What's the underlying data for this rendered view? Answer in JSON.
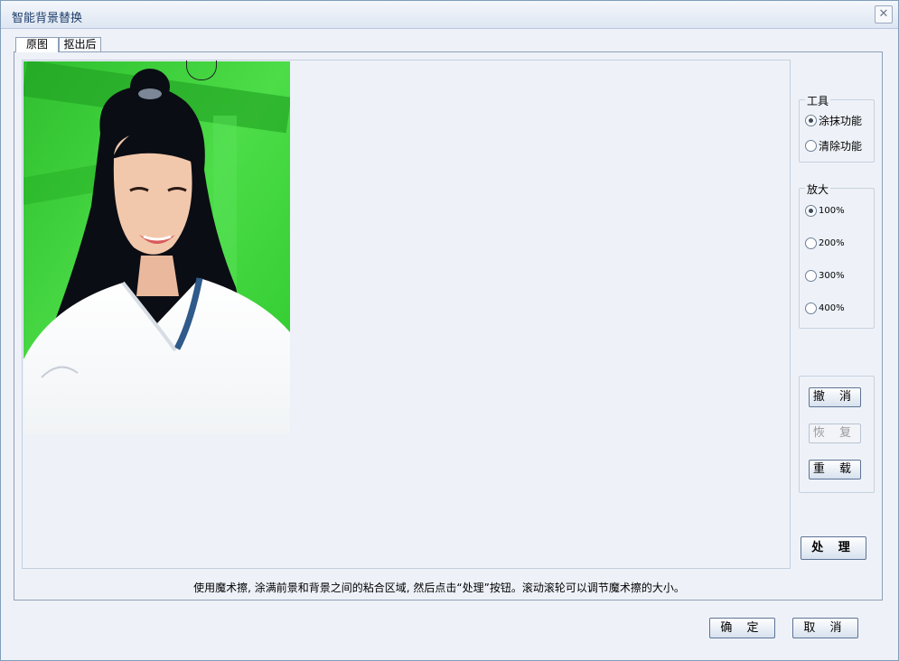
{
  "window": {
    "title": "智能背景替换",
    "close_icon": "close-icon"
  },
  "tabs": [
    {
      "label": "原图",
      "active": true
    },
    {
      "label": "抠出后",
      "active": false
    }
  ],
  "hint": "使用魔术擦, 涂满前景和背景之间的粘合区域, 然后点击“处理”按钮。滚动滚轮可以调节魔术擦的大小。",
  "tools": {
    "title": "工具",
    "options": [
      {
        "label": "涂抹功能",
        "checked": true
      },
      {
        "label": "清除功能",
        "checked": false
      }
    ]
  },
  "zoom": {
    "title": "放大",
    "options": [
      {
        "label": "100%",
        "checked": true
      },
      {
        "label": "200%",
        "checked": false
      },
      {
        "label": "300%",
        "checked": false
      },
      {
        "label": "400%",
        "checked": false
      }
    ]
  },
  "history": {
    "undo": "撤 消",
    "redo": "恢 复",
    "reload": "重 载"
  },
  "process": "处 理",
  "footer": {
    "ok": "确 定",
    "cancel": "取 消"
  },
  "colors": {
    "green_screen": "#38d838",
    "accent": "#5d7396"
  }
}
